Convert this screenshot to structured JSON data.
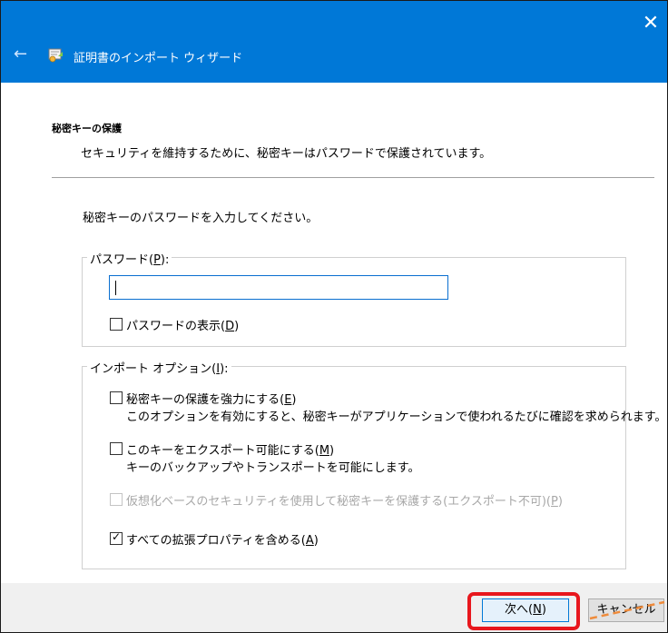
{
  "window": {
    "title": "証明書のインポート ウィザード",
    "back_icon": "arrow-left-icon",
    "close_icon": "close-icon",
    "close_glyph": "✕",
    "back_glyph": "←",
    "title_bar_color": "#0078d7"
  },
  "header": {
    "section_title": "秘密キーの保護",
    "section_desc": "セキュリティを維持するために、秘密キーはパスワードで保護されています。"
  },
  "body": {
    "instruction": "秘密キーのパスワードを入力してください。",
    "password_group": {
      "label": "パスワード(",
      "accel": "P",
      "label_end": "):",
      "value": "",
      "show_password": {
        "label": "パスワードの表示(",
        "accel": "D",
        "label_end": ")",
        "checked": false
      }
    },
    "import_options": {
      "label": "インポート オプション(",
      "accel": "I",
      "label_end": "):",
      "options": [
        {
          "label": "秘密キーの保護を強力にする(",
          "accel": "E",
          "label_end": ")",
          "desc": "このオプションを有効にすると、秘密キーがアプリケーションで使われるたびに確認を求められます。",
          "checked": false,
          "enabled": true
        },
        {
          "label": "このキーをエクスポート可能にする(",
          "accel": "M",
          "label_end": ")",
          "desc": "キーのバックアップやトランスポートを可能にします。",
          "checked": false,
          "enabled": true
        },
        {
          "label": "仮想化ベースのセキュリティを使用して秘密キーを保護する(エクスポート不可)(",
          "accel": "P",
          "label_end": ")",
          "desc": "",
          "checked": false,
          "enabled": false
        },
        {
          "label": "すべての拡張プロパティを含める(",
          "accel": "A",
          "label_end": ")",
          "desc": "",
          "checked": true,
          "enabled": true
        }
      ]
    }
  },
  "footer": {
    "next_button": {
      "label": "次へ(",
      "accel": "N",
      "label_end": ")"
    },
    "cancel_button": {
      "label": "キャンセル"
    },
    "highlight_color": "#e8171d",
    "strike_color": "#ef8b3b"
  },
  "checkmark_glyph": "✓"
}
